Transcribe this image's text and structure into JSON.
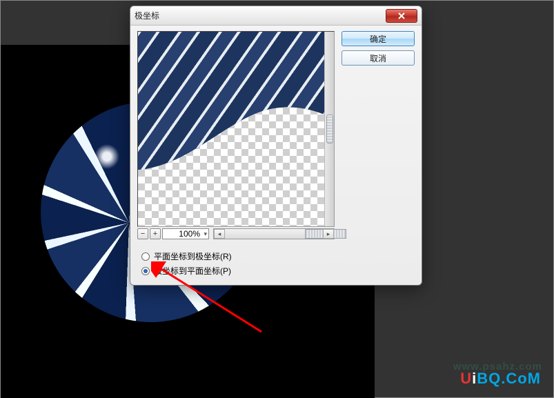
{
  "dialog": {
    "title": "极坐标",
    "ok_label": "确定",
    "cancel_label": "取消",
    "zoom_value": "100%",
    "options": {
      "rect_to_polar": "平面坐标到极坐标(R)",
      "polar_to_rect": "极坐标到平面坐标(P)",
      "selected": "polar_to_rect"
    }
  },
  "watermark": {
    "text": "UiBQ.CoM",
    "ghost": "www.psahz.com"
  }
}
